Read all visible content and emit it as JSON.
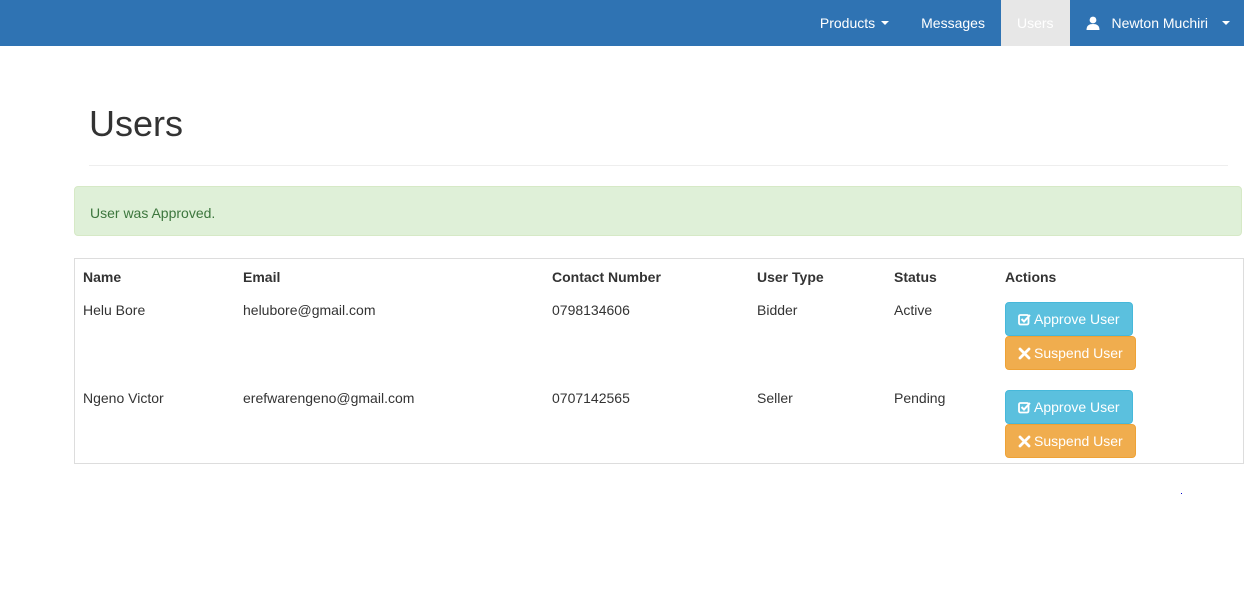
{
  "navbar": {
    "items": [
      {
        "label": "Products",
        "has_caret": true
      },
      {
        "label": "Messages",
        "has_caret": false
      },
      {
        "label": "Users",
        "active": true
      }
    ],
    "user": {
      "name": "Newton Muchiri",
      "icon": "user-icon"
    }
  },
  "page": {
    "title": "Users",
    "alert": "User was Approved."
  },
  "table": {
    "headers": [
      "Name",
      "Email",
      "Contact Number",
      "User Type",
      "Status",
      "Actions"
    ],
    "rows": [
      {
        "name": "Helu Bore",
        "email": "helubore@gmail.com",
        "contact": "0798134606",
        "type": "Bidder",
        "status": "Active"
      },
      {
        "name": "Ngeno Victor",
        "email": "erefwarengeno@gmail.com",
        "contact": "0707142565",
        "type": "Seller",
        "status": "Pending"
      }
    ],
    "actions": {
      "approve_label": "Approve User",
      "approve_icon": "check-square-icon",
      "suspend_label": "Suspend User",
      "suspend_icon": "times-icon"
    }
  },
  "colors": {
    "navbar": "#2f73b3",
    "alert_bg": "#dff0d8",
    "alert_text": "#3c763d",
    "approve": "#5bc0de",
    "suspend": "#f0ad4e"
  }
}
